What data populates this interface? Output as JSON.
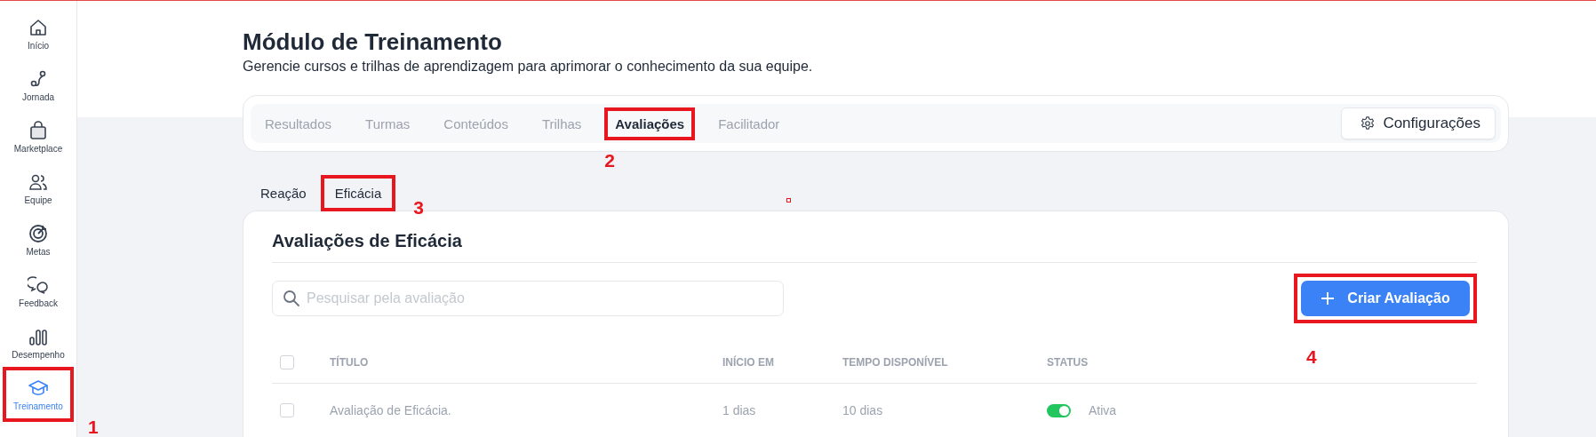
{
  "sidebar": {
    "items": [
      {
        "label": "Início",
        "selected": false
      },
      {
        "label": "Jornada",
        "selected": false
      },
      {
        "label": "Marketplace",
        "selected": false
      },
      {
        "label": "Equipe",
        "selected": false
      },
      {
        "label": "Metas",
        "selected": false
      },
      {
        "label": "Feedback",
        "selected": false
      },
      {
        "label": "Desempenho",
        "selected": false
      },
      {
        "label": "Treinamento",
        "selected": true,
        "annotation": "1"
      }
    ]
  },
  "page": {
    "title": "Módulo de Treinamento",
    "subtitle": "Gerencie cursos e trilhas de aprendizagem para aprimorar o conhecimento da sua equipe."
  },
  "tabs": [
    {
      "label": "Resultados",
      "selected": false
    },
    {
      "label": "Turmas",
      "selected": false
    },
    {
      "label": "Conteúdos",
      "selected": false
    },
    {
      "label": "Trilhas",
      "selected": false
    },
    {
      "label": "Avaliações",
      "selected": true,
      "annotation": "2"
    },
    {
      "label": "Facilitador",
      "selected": false
    }
  ],
  "settings_button": {
    "label": "Configurações"
  },
  "subtabs": [
    {
      "label": "Reação"
    },
    {
      "label": "Eficácia",
      "annotation": "3"
    }
  ],
  "card": {
    "title": "Avaliações de Eficácia",
    "search": {
      "placeholder": "Pesquisar pela avaliação"
    },
    "create_button": {
      "label": "Criar Avaliação",
      "annotation": "4"
    },
    "table": {
      "select_all_checked": false,
      "columns": [
        "TÍTULO",
        "INÍCIO EM",
        "TEMPO DISPONÍVEL",
        "STATUS"
      ],
      "rows": [
        {
          "checked": false,
          "title": "Avaliação de Eficácia.",
          "start": "1 dias",
          "duration": "10 dias",
          "status": {
            "on": true,
            "label": "Ativa"
          }
        }
      ]
    }
  }
}
